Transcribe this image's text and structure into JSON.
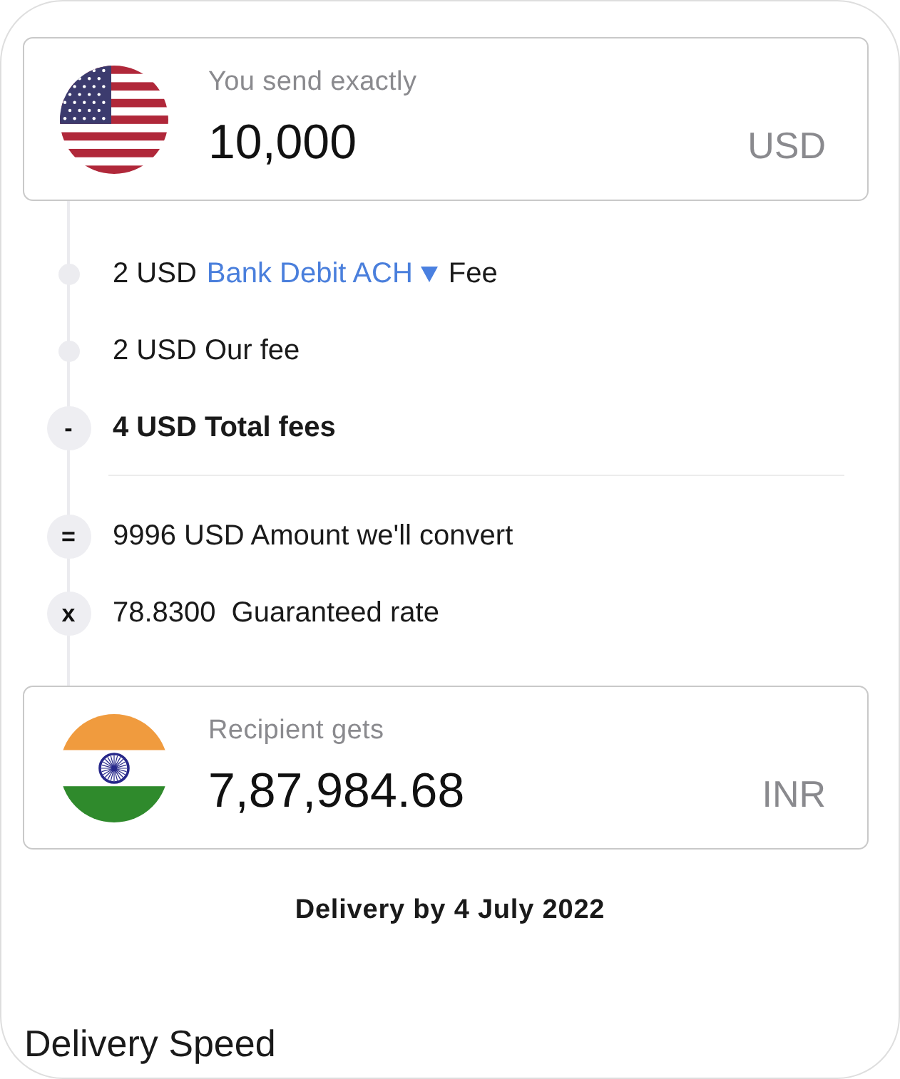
{
  "send": {
    "label": "You send exactly",
    "amount": "10,000",
    "currency": "USD"
  },
  "breakdown": [
    {
      "kind": "method_fee",
      "amount": "2 USD",
      "method": "Bank Debit ACH",
      "label": "Fee"
    },
    {
      "kind": "fee",
      "text": "2 USD Our fee"
    },
    {
      "kind": "total",
      "symbol": "-",
      "text": "4 USD Total fees"
    },
    {
      "kind": "result",
      "symbol": "=",
      "text": "9996 USD Amount we'll convert"
    },
    {
      "kind": "rate",
      "symbol": "x",
      "value": "78.8300",
      "label": "Guaranteed rate"
    }
  ],
  "receive": {
    "label": "Recipient gets",
    "amount": "7,87,984.68",
    "currency": "INR"
  },
  "delivery": "Delivery by 4 July 2022",
  "section_title": "Delivery Speed"
}
